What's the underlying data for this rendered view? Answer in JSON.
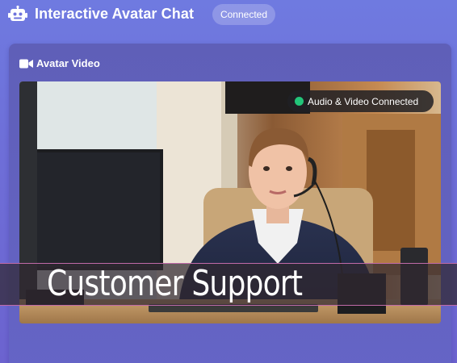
{
  "app": {
    "title": "Interactive Avatar Chat",
    "status": "Connected",
    "icon": "robot-icon"
  },
  "panel": {
    "title": "Avatar Video",
    "icon": "video-camera-icon"
  },
  "video": {
    "connection_status": "Audio & Video Connected",
    "connection_color": "#22c57a",
    "caption": "Customer Support"
  },
  "colors": {
    "background": "#6e6fd8",
    "panel": "#6262c0"
  }
}
